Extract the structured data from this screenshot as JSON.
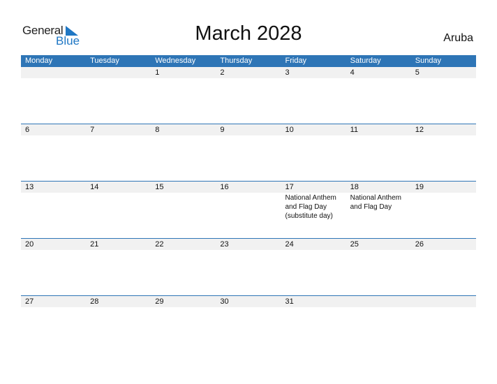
{
  "logo": {
    "general": "General",
    "blue": "Blue",
    "icon": "triangle-flag-icon"
  },
  "title": "March 2028",
  "country": "Aruba",
  "weekdays": [
    "Monday",
    "Tuesday",
    "Wednesday",
    "Thursday",
    "Friday",
    "Saturday",
    "Sunday"
  ],
  "weeks": [
    {
      "days": [
        "",
        "",
        "1",
        "2",
        "3",
        "4",
        "5"
      ],
      "events": [
        "",
        "",
        "",
        "",
        "",
        "",
        ""
      ]
    },
    {
      "days": [
        "6",
        "7",
        "8",
        "9",
        "10",
        "11",
        "12"
      ],
      "events": [
        "",
        "",
        "",
        "",
        "",
        "",
        ""
      ]
    },
    {
      "days": [
        "13",
        "14",
        "15",
        "16",
        "17",
        "18",
        "19"
      ],
      "events": [
        "",
        "",
        "",
        "",
        "National Anthem and Flag Day (substitute day)",
        "National Anthem and Flag Day",
        ""
      ]
    },
    {
      "days": [
        "20",
        "21",
        "22",
        "23",
        "24",
        "25",
        "26"
      ],
      "events": [
        "",
        "",
        "",
        "",
        "",
        "",
        ""
      ]
    },
    {
      "days": [
        "27",
        "28",
        "29",
        "30",
        "31",
        "",
        ""
      ],
      "events": [
        "",
        "",
        "",
        "",
        "",
        "",
        ""
      ]
    }
  ],
  "colors": {
    "header": "#2e75b6",
    "row_bg": "#f1f1f1",
    "logo_blue": "#1f77c4"
  }
}
